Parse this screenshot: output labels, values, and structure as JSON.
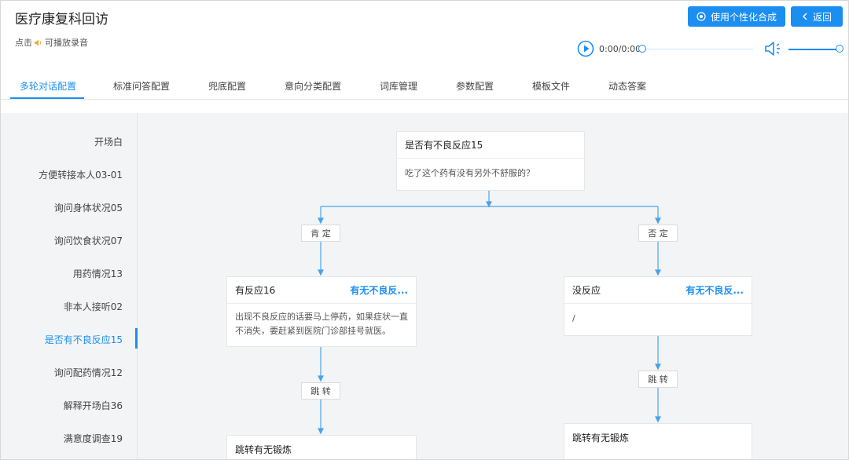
{
  "header": {
    "title": "医疗康复科回访",
    "synth_button": "使用个性化合成",
    "back_button": "返回",
    "hint_prefix": "点击",
    "hint_suffix": "可播放录音"
  },
  "player": {
    "time": "0:00/0:00",
    "progress": 0,
    "volume": 1.0
  },
  "tabs": [
    {
      "label": "多轮对话配置",
      "active": true
    },
    {
      "label": "标准问答配置"
    },
    {
      "label": "兜底配置"
    },
    {
      "label": "意向分类配置"
    },
    {
      "label": "词库管理"
    },
    {
      "label": "参数配置"
    },
    {
      "label": "模板文件"
    },
    {
      "label": "动态答案"
    }
  ],
  "sidebar": {
    "items": [
      {
        "label": "开场白"
      },
      {
        "label": "方便转接本人03-01"
      },
      {
        "label": "询问身体状况05"
      },
      {
        "label": "询问饮食状况07"
      },
      {
        "label": "用药情况13"
      },
      {
        "label": "非本人接听02"
      },
      {
        "label": "是否有不良反应15",
        "active": true
      },
      {
        "label": "询问配药情况12"
      },
      {
        "label": "解释开场白36"
      },
      {
        "label": "满意度调查19"
      }
    ]
  },
  "flow": {
    "root": {
      "title": "是否有不良反应15",
      "body": "吃了这个药有没有另外不舒服的？"
    },
    "branch_yes": "肯 定",
    "branch_no": "否 定",
    "left_node": {
      "title": "有反应16",
      "tag": "有无不良反...",
      "body": "出现不良反应的话要马上停药，如果症状一直不消失，要赶紧到医院门诊部挂号就医。"
    },
    "right_node": {
      "title": "没反应",
      "tag": "有无不良反...",
      "body": "/"
    },
    "jump_label": "跳 转",
    "left_jump_node": {
      "title": "跳转有无锻炼"
    },
    "right_jump_node": {
      "title": "跳转有无锻炼"
    }
  },
  "colors": {
    "accent": "#1b8ef2",
    "connector": "#4aa3e8"
  }
}
